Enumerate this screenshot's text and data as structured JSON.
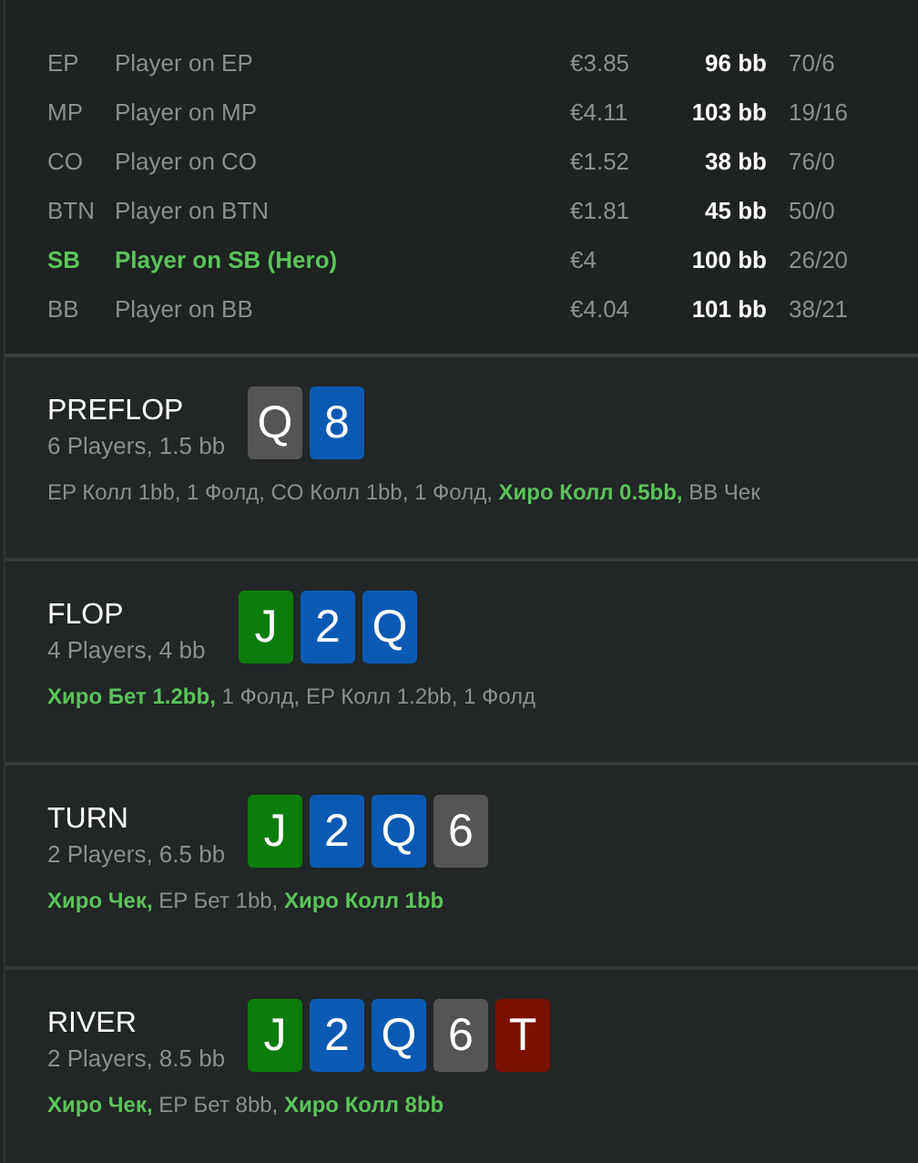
{
  "players": [
    {
      "position": "EP",
      "name": "Player on EP",
      "money": "€3.85",
      "stack": "96 bb",
      "stats": "70/6",
      "hero": false
    },
    {
      "position": "MP",
      "name": "Player on MP",
      "money": "€4.11",
      "stack": "103 bb",
      "stats": "19/16",
      "hero": false
    },
    {
      "position": "CO",
      "name": "Player on CO",
      "money": "€1.52",
      "stack": "38 bb",
      "stats": "76/0",
      "hero": false
    },
    {
      "position": "BTN",
      "name": "Player on BTN",
      "money": "€1.81",
      "stack": "45 bb",
      "stats": "50/0",
      "hero": false
    },
    {
      "position": "SB",
      "name": "Player on SB (Hero)",
      "money": "€4",
      "stack": "100 bb",
      "stats": "26/20",
      "hero": true
    },
    {
      "position": "BB",
      "name": "Player on BB",
      "money": "€4.04",
      "stack": "101 bb",
      "stats": "38/21",
      "hero": false
    }
  ],
  "streets": [
    {
      "title": "PREFLOP",
      "subtitle": "6 Players, 1.5 bb",
      "cards": [
        {
          "rank": "Q",
          "color": "#555555"
        },
        {
          "rank": "8",
          "color": "#0a5ab4"
        }
      ],
      "actions": "EP Колл 1bb, 1 Фолд, CO Колл 1bb, 1 Фолд, **Хиро Колл 0.5bb,** BB Чек"
    },
    {
      "title": "FLOP",
      "subtitle": "4 Players, 4 bb",
      "cards": [
        {
          "rank": "J",
          "color": "#0b7d0b"
        },
        {
          "rank": "2",
          "color": "#0a5ab4"
        },
        {
          "rank": "Q",
          "color": "#0a5ab4"
        }
      ],
      "actions": "**Хиро Бет 1.2bb,** 1 Фолд, EP Колл 1.2bb, 1 Фолд"
    },
    {
      "title": "TURN",
      "subtitle": "2 Players, 6.5 bb",
      "cards": [
        {
          "rank": "J",
          "color": "#0b7d0b"
        },
        {
          "rank": "2",
          "color": "#0a5ab4"
        },
        {
          "rank": "Q",
          "color": "#0a5ab4"
        },
        {
          "rank": "6",
          "color": "#555555"
        }
      ],
      "actions": "**Хиро Чек,** EP Бет 1bb, **Хиро Колл 1bb**"
    },
    {
      "title": "RIVER",
      "subtitle": "2 Players, 8.5 bb",
      "cards": [
        {
          "rank": "J",
          "color": "#0b7d0b"
        },
        {
          "rank": "2",
          "color": "#0a5ab4"
        },
        {
          "rank": "Q",
          "color": "#0a5ab4"
        },
        {
          "rank": "6",
          "color": "#555555"
        },
        {
          "rank": "T",
          "color": "#7a1000"
        }
      ],
      "actions": "**Хиро Чек,** EP Бет 8bb, **Хиро Колл 8bb**"
    }
  ]
}
